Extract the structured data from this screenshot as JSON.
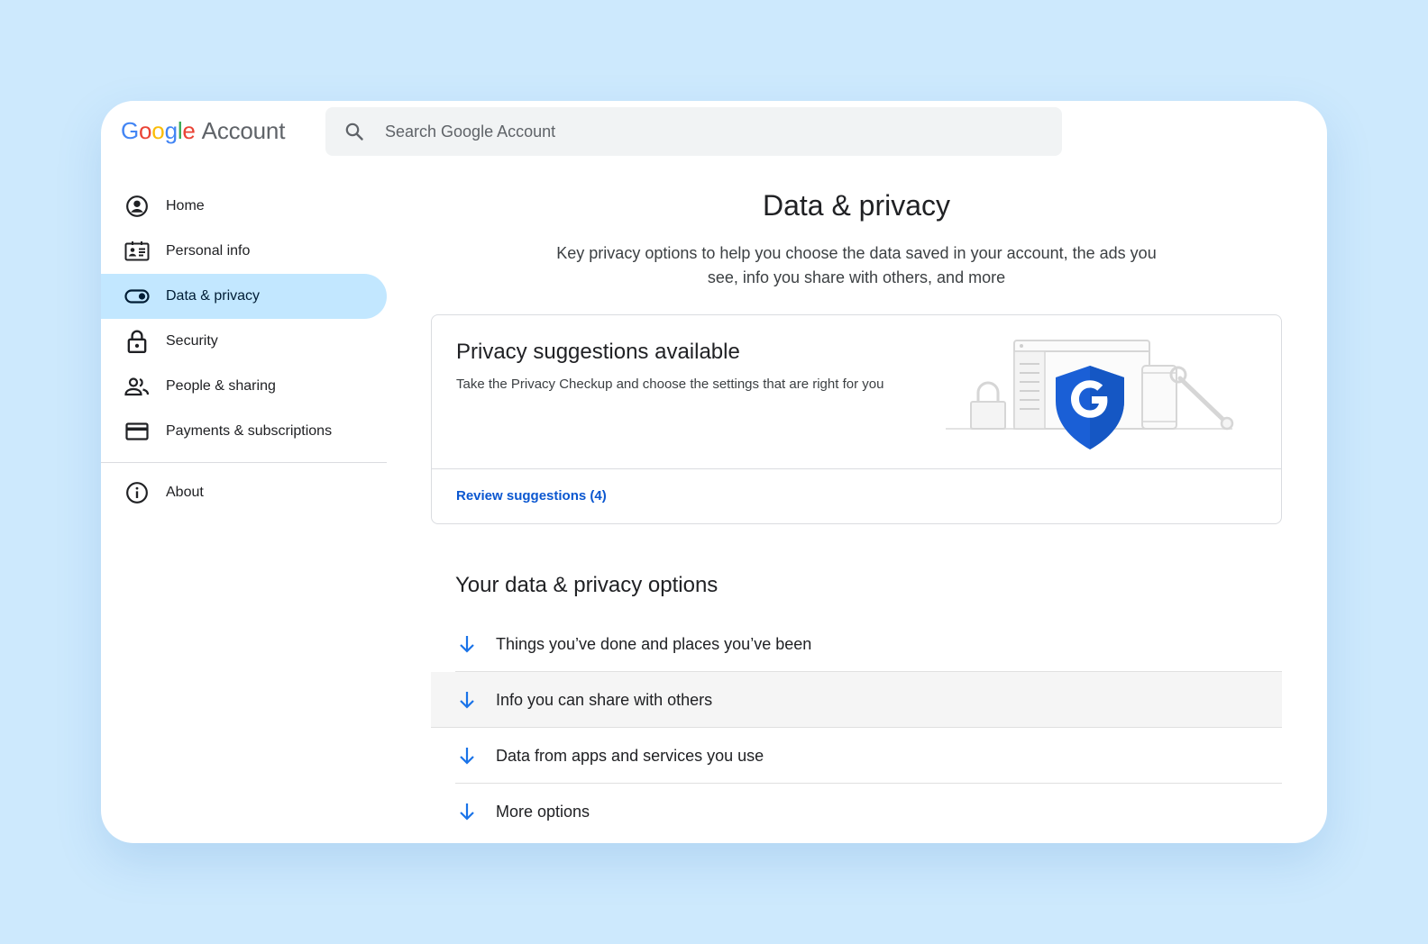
{
  "brand": {
    "google_letters": [
      {
        "char": "G",
        "color": "#4285F4"
      },
      {
        "char": "o",
        "color": "#EA4335"
      },
      {
        "char": "o",
        "color": "#FBBC05"
      },
      {
        "char": "g",
        "color": "#4285F4"
      },
      {
        "char": "l",
        "color": "#34A853"
      },
      {
        "char": "e",
        "color": "#EA4335"
      }
    ],
    "account_label": "Account"
  },
  "search": {
    "placeholder": "Search Google Account",
    "icon": "search-icon"
  },
  "sidebar": {
    "items": [
      {
        "label": "Home",
        "icon": "account-circle-icon",
        "active": false
      },
      {
        "label": "Personal info",
        "icon": "id-card-icon",
        "active": false
      },
      {
        "label": "Data & privacy",
        "icon": "toggle-icon",
        "active": true
      },
      {
        "label": "Security",
        "icon": "lock-icon",
        "active": false
      },
      {
        "label": "People & sharing",
        "icon": "people-icon",
        "active": false
      },
      {
        "label": "Payments & subscriptions",
        "icon": "credit-card-icon",
        "active": false
      }
    ],
    "footer_items": [
      {
        "label": "About",
        "icon": "info-icon"
      }
    ]
  },
  "main": {
    "title": "Data & privacy",
    "subtitle": "Key privacy options to help you choose the data saved in your account, the ads you see, info you share with others, and more",
    "privacy_card": {
      "title": "Privacy suggestions available",
      "description": "Take the Privacy Checkup and choose the settings that are right for you",
      "link_label": "Review suggestions (4)",
      "illustration": "google-shield-illustration"
    },
    "options_section": {
      "title": "Your data & privacy options",
      "items": [
        {
          "label": "Things you’ve done and places you’ve been",
          "hovered": false
        },
        {
          "label": "Info you can share with others",
          "hovered": true
        },
        {
          "label": "Data from apps and services you use",
          "hovered": false
        },
        {
          "label": "More options",
          "hovered": false
        }
      ]
    }
  },
  "colors": {
    "background": "#cde9fd",
    "active_nav": "#c2e7ff",
    "link_blue": "#0b57d0",
    "arrow_blue": "#1a73e8",
    "shield_blue": "#1a5fd6"
  }
}
